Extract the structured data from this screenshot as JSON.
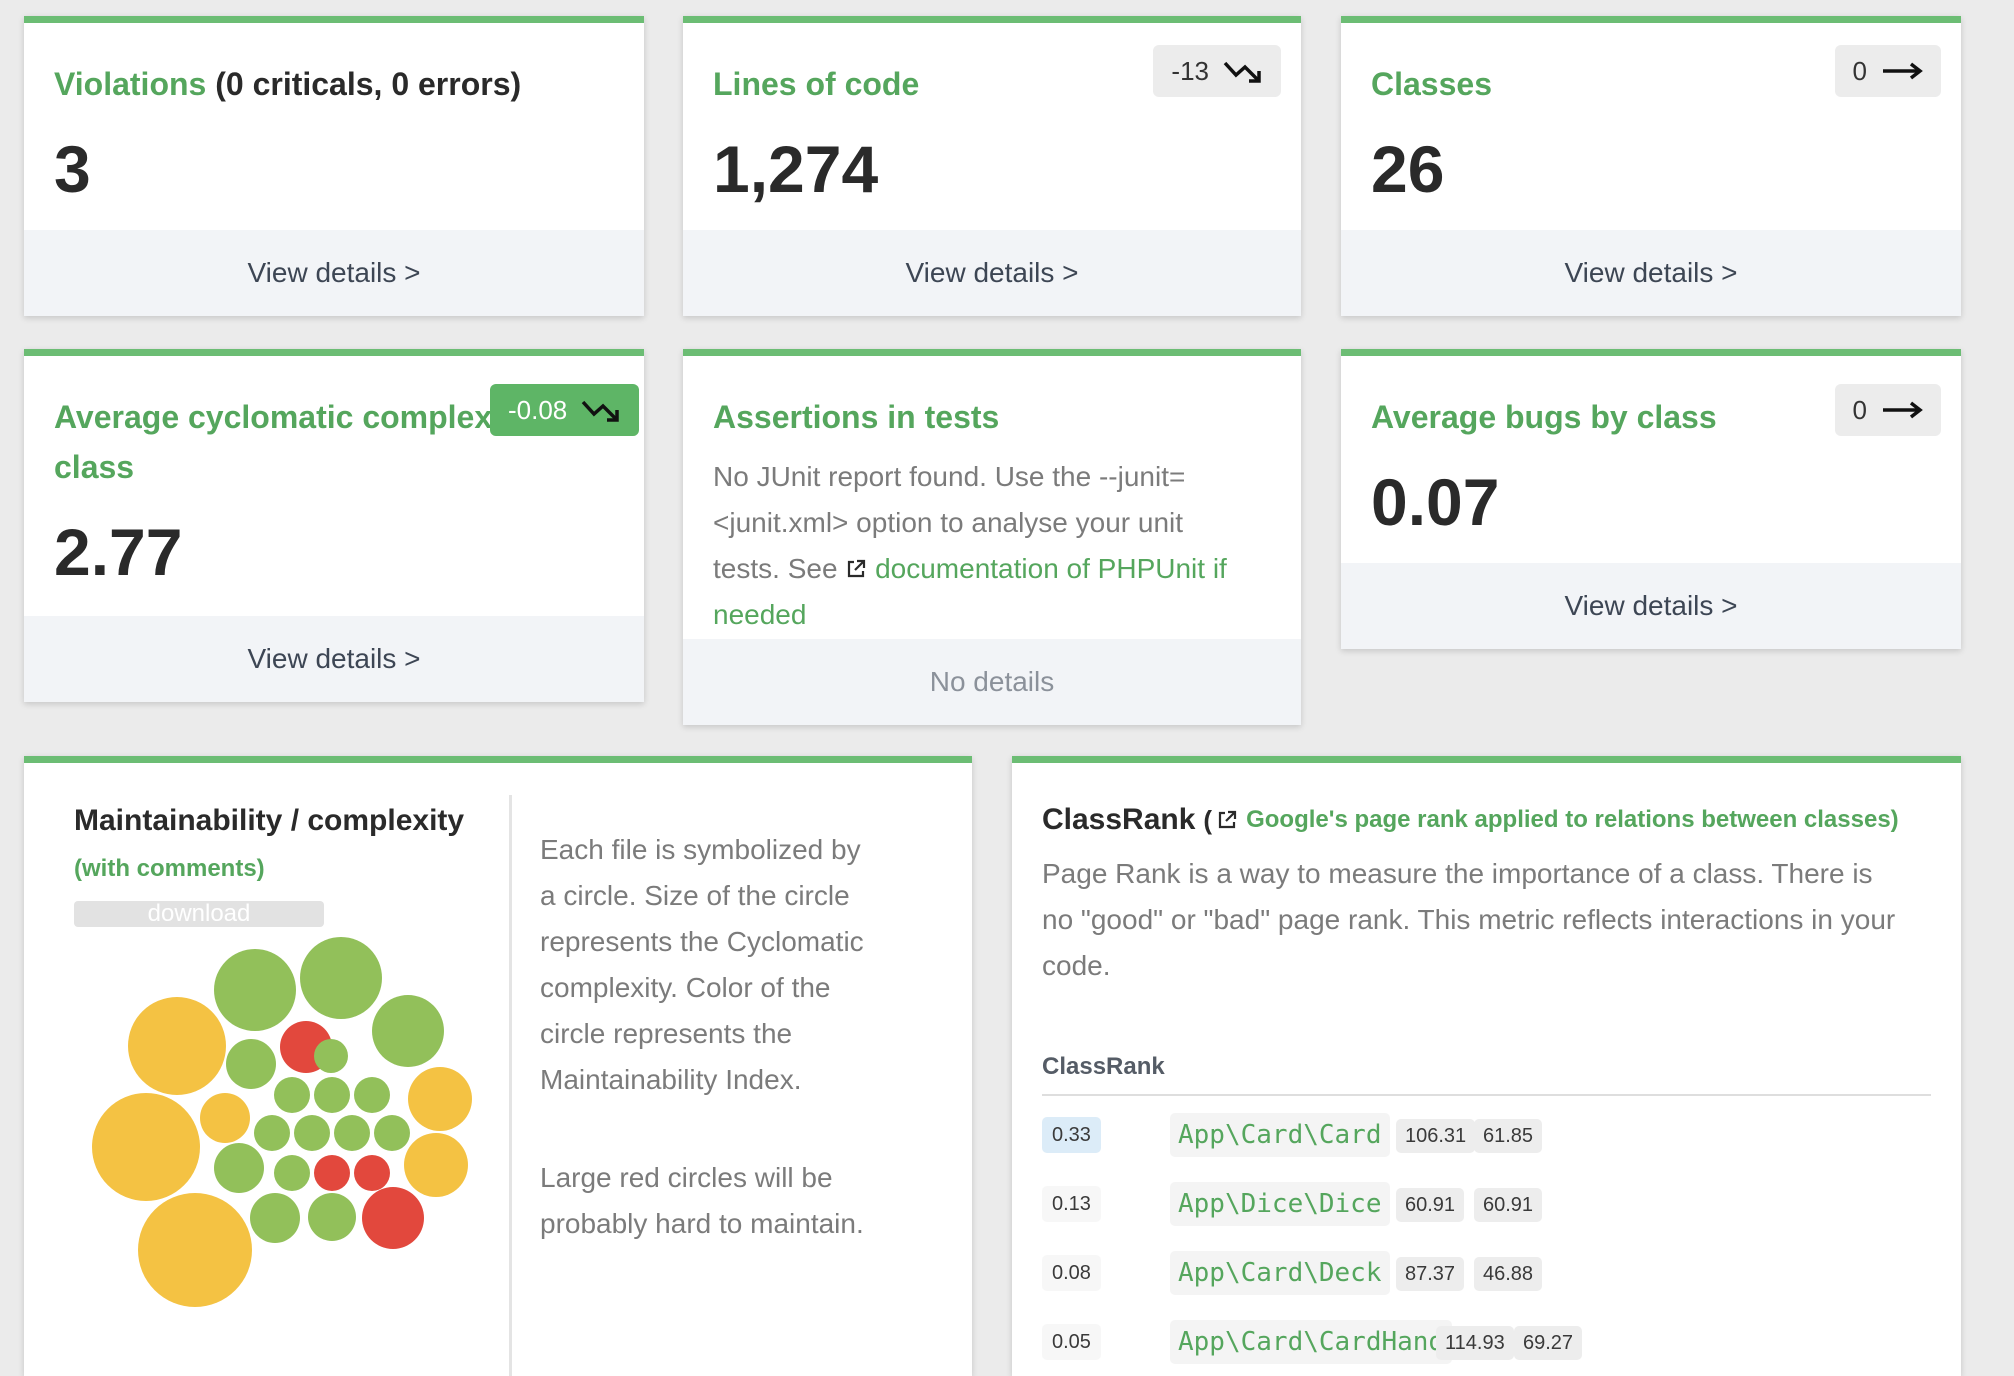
{
  "cards": {
    "violations": {
      "title": "Violations",
      "subtitle": "(0 criticals, 0 errors)",
      "value": "3",
      "footer": "View details >"
    },
    "loc": {
      "title": "Lines of code",
      "value": "1,274",
      "trend": "-13",
      "trend_icon": "trend-down-icon",
      "footer": "View details >"
    },
    "classes": {
      "title": "Classes",
      "value": "26",
      "trend": "0",
      "trend_icon": "arrow-right-icon",
      "footer": "View details >"
    },
    "cyclomatic": {
      "title": "Average cyclomatic complexity by class",
      "title_line1": "Average cyclomatic complexity by",
      "title_line2": "class",
      "value": "2.77",
      "trend": "-0.08",
      "trend_icon": "trend-down-icon",
      "footer": "View details >"
    },
    "assertions": {
      "title": "Assertions in tests",
      "text_line1": "No JUnit report found. Use the --junit=",
      "text_line2": "<junit.xml> option to analyse your unit",
      "text_line3_prefix": "tests. See ",
      "link_line1": "documentation of PHPUnit if",
      "link_line2": "needed",
      "link_icon": "external-link-icon",
      "footer": "No details"
    },
    "bugs": {
      "title": "Average bugs by class",
      "value": "0.07",
      "trend": "0",
      "trend_icon": "arrow-right-icon",
      "footer": "View details >"
    }
  },
  "maintainability": {
    "title": "Maintainability / complexity",
    "subtitle": "(with comments)",
    "download_label": "download",
    "description_lines": [
      "Each file is symbolized by",
      "a circle. Size of the circle",
      "represents the Cyclomatic",
      "complexity. Color of the",
      "circle represents the",
      "Maintainability Index."
    ],
    "description2_lines": [
      "Large red circles will be",
      "probably hard to maintain."
    ],
    "colors": {
      "good": "#92c05a",
      "warning": "#f4c243",
      "bad": "#e2483d"
    }
  },
  "classrank": {
    "title": "ClassRank",
    "subtitle": "Google's page rank applied to relations between classes)",
    "subtitle_open": "(",
    "subtitle_icon": "external-link-icon",
    "description_lines": [
      "Page Rank is a way to measure the importance of a class. There is",
      "no \"good\" or \"bad\" page rank. This metric reflects interactions in your",
      "code."
    ],
    "section_label": "ClassRank",
    "rows": [
      {
        "score": "0.33",
        "name": "App\\Card\\Card",
        "tags": [
          "106.31",
          "61.85"
        ]
      },
      {
        "score": "0.13",
        "name": "App\\Dice\\Dice",
        "tags": [
          "60.91",
          "60.91"
        ]
      },
      {
        "score": "0.08",
        "name": "App\\Card\\Deck",
        "tags": [
          "87.37",
          "46.88"
        ]
      },
      {
        "score": "0.05",
        "name": "App\\Card\\CardHand",
        "tags": [
          "114.93",
          "69.27"
        ]
      }
    ]
  },
  "accent_color": "#6cbd74"
}
